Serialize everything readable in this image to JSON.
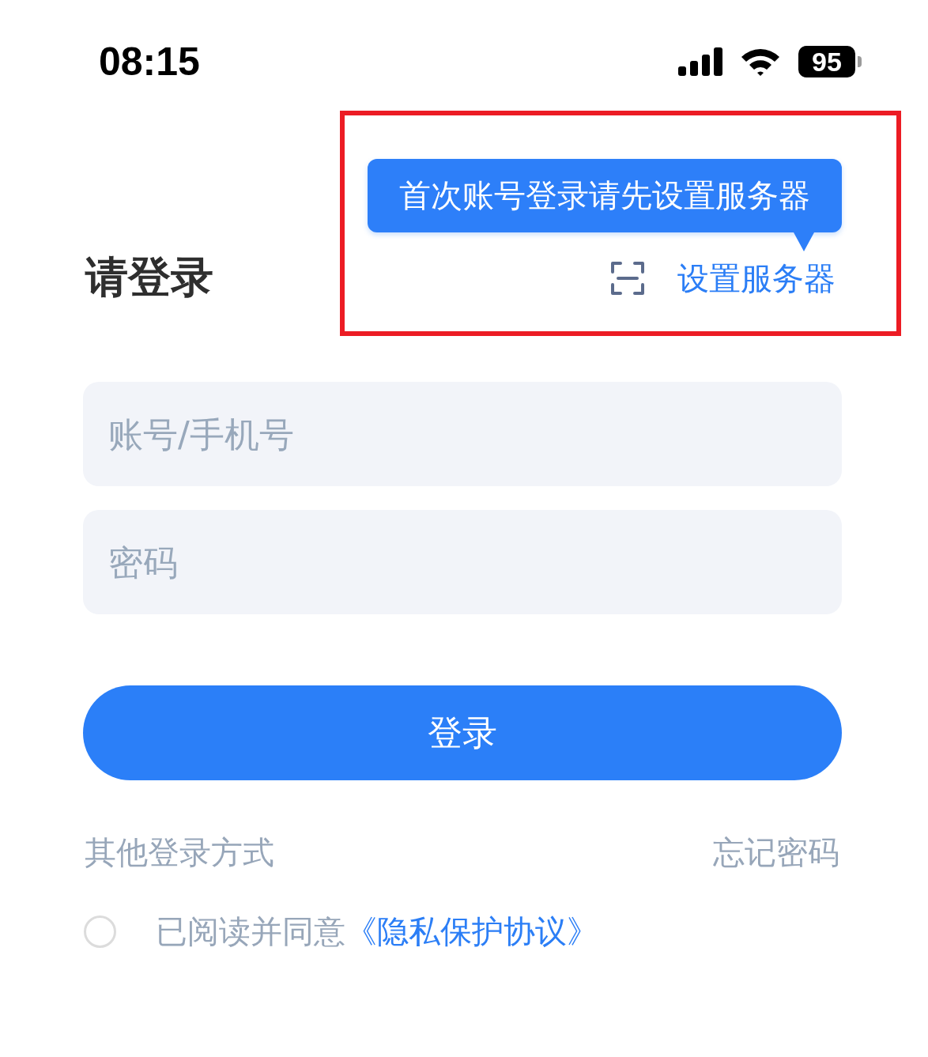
{
  "status_bar": {
    "time": "08:15",
    "battery": "95"
  },
  "title": "请登录",
  "tooltip": {
    "text": "首次账号登录请先设置服务器"
  },
  "set_server": {
    "label": "设置服务器"
  },
  "fields": [
    {
      "placeholder": "账号/手机号"
    },
    {
      "placeholder": "密码"
    }
  ],
  "login_button": {
    "label": "登录"
  },
  "links": {
    "other_login": "其他登录方式",
    "forgot_password": "忘记密码"
  },
  "agreement": {
    "checked": false,
    "text": "已阅读并同意",
    "link": "《隐私保护协议》"
  }
}
